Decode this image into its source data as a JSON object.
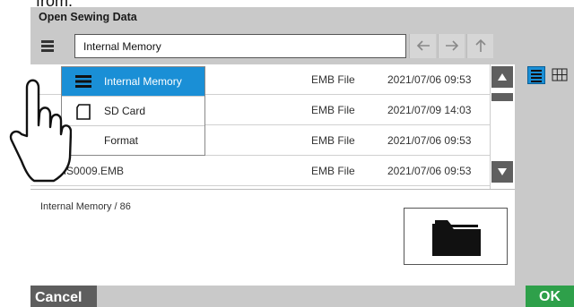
{
  "top_text": "from.",
  "dialog": {
    "title": "Open Sewing Data"
  },
  "location": {
    "icon": "storage-list-icon",
    "path": "Internal Memory"
  },
  "nav": {
    "back_icon": "arrow-left-icon",
    "forward_icon": "arrow-right-icon",
    "up_icon": "arrow-up-icon"
  },
  "files": [
    {
      "name": "",
      "type": "EMB File",
      "date": "2021/07/06 09:53"
    },
    {
      "name": "",
      "type": "EMB File",
      "date": "2021/07/09 14:03"
    },
    {
      "name": "",
      "type": "EMB File",
      "date": "2021/07/06 09:53"
    },
    {
      "name": "MS0009.EMB",
      "type": "EMB File",
      "date": "2021/07/06 09:53"
    }
  ],
  "dropdown": {
    "items": [
      {
        "label": "Internal Memory",
        "icon": "internal-memory-icon",
        "selected": true
      },
      {
        "label": "SD Card",
        "icon": "sd-card-icon",
        "selected": false
      },
      {
        "label": "Format",
        "icon": "format-icon",
        "selected": false
      }
    ]
  },
  "status": "Internal Memory / 86",
  "buttons": {
    "cancel": "Cancel",
    "ok": "OK"
  },
  "colors": {
    "accent": "#1a8fd6",
    "ok": "#2ea04a",
    "cancel": "#5e5e5e",
    "dialog_bg": "#c9c9c9"
  }
}
